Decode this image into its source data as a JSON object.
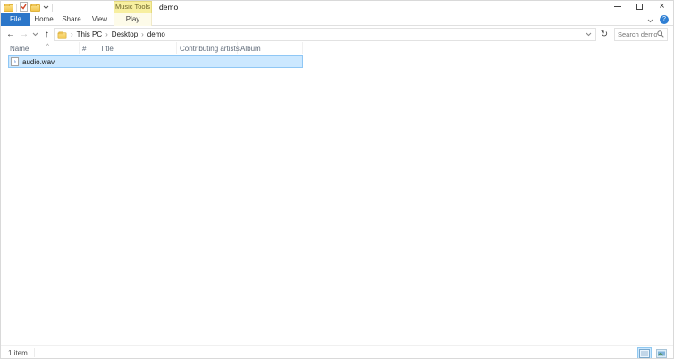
{
  "titlebar": {
    "contextual_group": "Music Tools",
    "title": "demo"
  },
  "qat": {
    "icons": [
      "folder-icon",
      "properties-icon",
      "new-folder-icon",
      "customize-quick-access-chevron"
    ]
  },
  "ribbon": {
    "tabs": [
      {
        "label": "File",
        "active": true
      },
      {
        "label": "Home",
        "active": false
      },
      {
        "label": "Share",
        "active": false
      },
      {
        "label": "View",
        "active": false
      },
      {
        "label": "Play",
        "active": false,
        "contextual": true
      }
    ],
    "help_glyph": "?"
  },
  "address_bar": {
    "breadcrumb": [
      "This PC",
      "Desktop",
      "demo"
    ],
    "crumb_separator": "›",
    "back_glyph": "←",
    "forward_glyph": "→",
    "up_glyph": "↑",
    "refresh_glyph": "↻"
  },
  "search": {
    "placeholder": "Search demo"
  },
  "list": {
    "columns": [
      {
        "label": "Name",
        "sort": "asc"
      },
      {
        "label": "#",
        "sort": ""
      },
      {
        "label": "Title",
        "sort": ""
      },
      {
        "label": "Contributing artists",
        "sort": ""
      },
      {
        "label": "Album",
        "sort": ""
      }
    ],
    "sort_caret": "^",
    "files": [
      {
        "name": "audio.wav",
        "type": "audio",
        "selected": true,
        "icon_glyph": "♪"
      }
    ]
  },
  "status_bar": {
    "items_count": "1 item"
  },
  "colors": {
    "file_tab_blue": "#2b76c9",
    "contextual_tab_yellow": "#f7efa0",
    "contextual_tab_border": "#e6da7e",
    "play_tab_bg": "#fdfbe9",
    "selection_fill": "#cce8ff",
    "selection_border": "#8fc7f5",
    "header_text": "#616c7a",
    "help_blue": "#2e7fd4"
  }
}
